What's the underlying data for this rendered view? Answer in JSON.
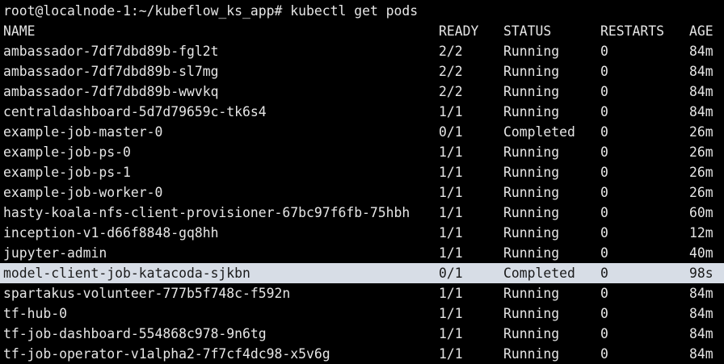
{
  "terminal": {
    "prompt": "root@localnode-1:~/kubeflow_ks_app#",
    "command": "kubectl get pods"
  },
  "table": {
    "headers": {
      "name": "NAME",
      "ready": "READY",
      "status": "STATUS",
      "restarts": "RESTARTS",
      "age": "AGE"
    },
    "highlighted_row": 11,
    "rows": [
      {
        "name": "ambassador-7df7dbd89b-fgl2t",
        "ready": "2/2",
        "status": "Running",
        "restarts": "0",
        "age": "84m"
      },
      {
        "name": "ambassador-7df7dbd89b-sl7mg",
        "ready": "2/2",
        "status": "Running",
        "restarts": "0",
        "age": "84m"
      },
      {
        "name": "ambassador-7df7dbd89b-wwvkq",
        "ready": "2/2",
        "status": "Running",
        "restarts": "0",
        "age": "84m"
      },
      {
        "name": "centraldashboard-5d7d79659c-tk6s4",
        "ready": "1/1",
        "status": "Running",
        "restarts": "0",
        "age": "84m"
      },
      {
        "name": "example-job-master-0",
        "ready": "0/1",
        "status": "Completed",
        "restarts": "0",
        "age": "26m"
      },
      {
        "name": "example-job-ps-0",
        "ready": "1/1",
        "status": "Running",
        "restarts": "0",
        "age": "26m"
      },
      {
        "name": "example-job-ps-1",
        "ready": "1/1",
        "status": "Running",
        "restarts": "0",
        "age": "26m"
      },
      {
        "name": "example-job-worker-0",
        "ready": "1/1",
        "status": "Running",
        "restarts": "0",
        "age": "26m"
      },
      {
        "name": "hasty-koala-nfs-client-provisioner-67bc97f6fb-75hbh",
        "ready": "1/1",
        "status": "Running",
        "restarts": "0",
        "age": "60m"
      },
      {
        "name": "inception-v1-d66f8848-gq8hh",
        "ready": "1/1",
        "status": "Running",
        "restarts": "0",
        "age": "12m"
      },
      {
        "name": "jupyter-admin",
        "ready": "1/1",
        "status": "Running",
        "restarts": "0",
        "age": "40m"
      },
      {
        "name": "model-client-job-katacoda-sjkbn",
        "ready": "0/1",
        "status": "Completed",
        "restarts": "0",
        "age": "98s"
      },
      {
        "name": "spartakus-volunteer-777b5f748c-f592n",
        "ready": "1/1",
        "status": "Running",
        "restarts": "0",
        "age": "84m"
      },
      {
        "name": "tf-hub-0",
        "ready": "1/1",
        "status": "Running",
        "restarts": "0",
        "age": "84m"
      },
      {
        "name": "tf-job-dashboard-554868c978-9n6tg",
        "ready": "1/1",
        "status": "Running",
        "restarts": "0",
        "age": "84m"
      },
      {
        "name": "tf-job-operator-v1alpha2-7f7cf4dc98-x5v6g",
        "ready": "1/1",
        "status": "Running",
        "restarts": "0",
        "age": "84m"
      }
    ]
  },
  "colors": {
    "background": "#000000",
    "text": "#e6e6e6",
    "highlight_background": "#d7dde6",
    "highlight_text": "#1a1a1a"
  }
}
